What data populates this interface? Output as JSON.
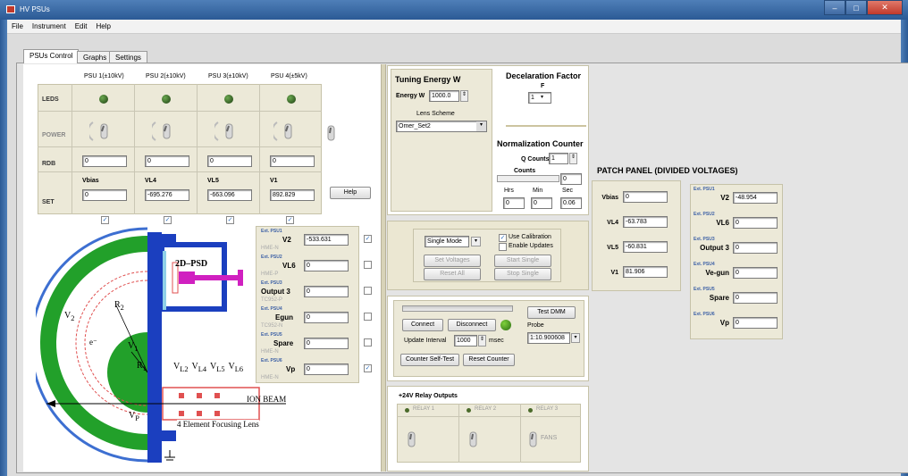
{
  "window": {
    "title": "HV PSUs",
    "min": "–",
    "max": "□",
    "close": "✕"
  },
  "menu": [
    "File",
    "Instrument",
    "Edit",
    "Help"
  ],
  "tabs": [
    "PSUs Control",
    "Graphs",
    "Settings"
  ],
  "psu_headers": [
    "PSU 1(±10kV)",
    "PSU 2(±10kV)",
    "PSU 3(±10kV)",
    "PSU 4(±5kV)"
  ],
  "row_labels": {
    "leds": "LEDS",
    "power": "POWER",
    "rdb": "RDB",
    "set": "SET"
  },
  "rdb_values": [
    "0",
    "0",
    "0",
    "0"
  ],
  "set_fields": [
    {
      "name": "Vbias",
      "value": "0"
    },
    {
      "name": "VL4",
      "value": "-695.276"
    },
    {
      "name": "VL5",
      "value": "-663.096"
    },
    {
      "name": "V1",
      "value": "892.829"
    }
  ],
  "help_label": "Help",
  "diagram": {
    "psd": "2D–PSD",
    "ion_beam": "ION BEAM",
    "lens": "4 Element Focusing Lens",
    "v2": "V",
    "v2sub": "2",
    "r2": "R",
    "r2sub": "2",
    "v1": "V",
    "v1sub": "1",
    "r1": "R",
    "r1sub": "1",
    "e": "e⁻",
    "vl": [
      "V",
      "V",
      "V",
      "V"
    ],
    "vlsub": [
      "L2",
      "L4",
      "L5",
      "L6"
    ],
    "vp": "V",
    "vpsub": "P"
  },
  "ext_psus": [
    {
      "tag": "Ext. PSU1",
      "label": "V2",
      "value": "-533.631",
      "sub": "HME-N",
      "checked": true
    },
    {
      "tag": "Ext. PSU2",
      "label": "VL6",
      "value": "0",
      "sub": "HME-P",
      "checked": false
    },
    {
      "tag": "Ext. PSU3",
      "label": "Output 3",
      "value": "0",
      "sub": "TC952-P",
      "checked": false
    },
    {
      "tag": "Ext. PSU4",
      "label": "Egun",
      "value": "0",
      "sub": "TC952-N",
      "checked": false
    },
    {
      "tag": "Ext. PSU5",
      "label": "Spare",
      "value": "0",
      "sub": "HME-N",
      "checked": false
    },
    {
      "tag": "Ext. PSU6",
      "label": "Vp",
      "value": "0",
      "sub": "HME-N",
      "checked": true
    }
  ],
  "tuning": {
    "title": "Tuning Energy W",
    "energy_label": "Energy W",
    "energy_value": "1000.0",
    "lens_scheme_label": "Lens Scheme",
    "lens_scheme_value": "Omer_Set2"
  },
  "decel": {
    "title": "Decelaration Factor",
    "f_label": "F",
    "f_value": "1"
  },
  "norm": {
    "title": "Normalization Counter",
    "q_label": "Q Counts",
    "q_value": "1",
    "counts_label": "Counts",
    "counts_value": "0",
    "hrs_label": "Hrs",
    "min_label": "Min",
    "sec_label": "Sec",
    "hrs": "0",
    "min": "0",
    "sec": "0.06"
  },
  "mode": {
    "value": "Single Mode",
    "use_cal": "Use Calibration",
    "enable_updates": "Enable Updates",
    "set_voltages": "Set Voltages",
    "start_single": "Start Single",
    "reset_all": "Reset All",
    "stop_single": "Stop Single"
  },
  "dmm": {
    "connect": "Connect",
    "disconnect": "Disconnect",
    "test": "Test DMM",
    "probe_label": "Probe",
    "probe_value": "1:10.900608",
    "interval_label": "Update Interval",
    "interval_value": "1000",
    "msec": "msec",
    "self_test": "Counter Self-Test",
    "reset_counter": "Reset Counter"
  },
  "relay": {
    "title": "+24V Relay Outputs",
    "relays": [
      "RELAY 1",
      "RELAY 2",
      "RELAY 3"
    ],
    "fans": "FANS"
  },
  "patch": {
    "title": "PATCH PANEL (DIVIDED VOLTAGES)",
    "left": [
      {
        "label": "Vbias",
        "value": "0"
      },
      {
        "label": "VL4",
        "value": "-63.783"
      },
      {
        "label": "VL5",
        "value": "-60.831"
      },
      {
        "label": "V1",
        "value": "81.906"
      }
    ],
    "right": [
      {
        "tag": "Ext. PSU1",
        "label": "V2",
        "value": "-48.954"
      },
      {
        "tag": "Ext. PSU2",
        "label": "VL6",
        "value": "0"
      },
      {
        "tag": "Ext. PSU3",
        "label": "Output 3",
        "value": "0"
      },
      {
        "tag": "Ext. PSU4",
        "label": "Ve-gun",
        "value": "0"
      },
      {
        "tag": "Ext. PSU5",
        "label": "Spare",
        "value": "0"
      },
      {
        "tag": "Ext. PSU6",
        "label": "Vp",
        "value": "0"
      }
    ]
  }
}
